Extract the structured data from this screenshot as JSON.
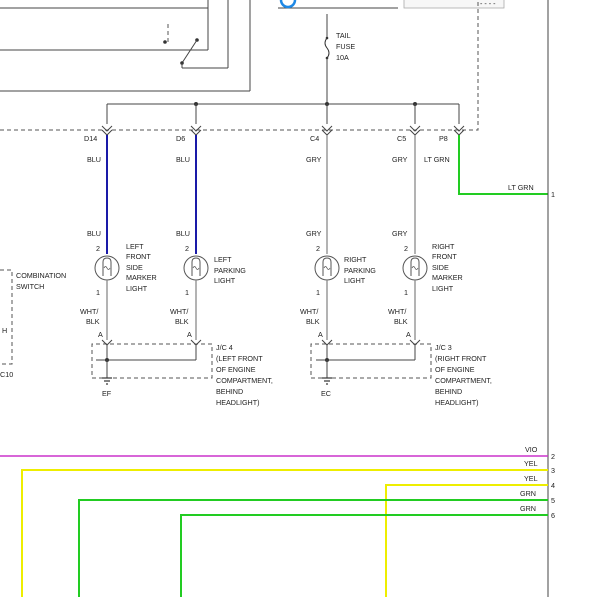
{
  "fuse": {
    "line1": "TAIL",
    "line2": "FUSE",
    "line3": "10A"
  },
  "connectors": {
    "d14": "D14",
    "d6": "D6",
    "c4": "C4",
    "c5": "C5",
    "p8": "P8",
    "a": "A",
    "pin1": "1",
    "pin2": "2"
  },
  "wires": {
    "blu": "BLU",
    "gry": "GRY",
    "lt_grn": "LT GRN",
    "wht_blk_1": "WHT/",
    "wht_blk_2": "BLK",
    "vio": "VIO",
    "yel": "YEL",
    "grn": "GRN"
  },
  "lights": {
    "left_front_side_marker": [
      "LEFT",
      "FRONT",
      "SIDE",
      "MARKER",
      "LIGHT"
    ],
    "left_parking": [
      "LEFT",
      "PARKING",
      "LIGHT"
    ],
    "right_parking": [
      "RIGHT",
      "PARKING",
      "LIGHT"
    ],
    "right_front_side_marker": [
      "RIGHT",
      "FRONT",
      "SIDE",
      "MARKER",
      "LIGHT"
    ]
  },
  "junctions": {
    "jc4": [
      "J/C 4",
      "(LEFT FRONT",
      "OF ENGINE",
      "COMPARTMENT,",
      "BEHIND",
      "HEADLIGHT)"
    ],
    "jc3": [
      "J/C 3",
      "(RIGHT FRONT",
      "OF ENGINE",
      "COMPARTMENT,",
      "BEHIND",
      "HEADLIGHT)"
    ]
  },
  "grounds": {
    "ef": "EF",
    "ec": "EC"
  },
  "combination_switch": {
    "line1": "COMBINATION",
    "line2": "SWITCH",
    "partial_h": "H",
    "partial_c10": "C10"
  },
  "right_pins": {
    "p1": "1",
    "p2": "2",
    "p3": "3",
    "p4": "4",
    "p5": "5",
    "p6": "6"
  },
  "colors": {
    "blu": "#1a1aa8",
    "gry": "#8a8a8a",
    "lt_grn": "#22cc22",
    "vio": "#cc33cc",
    "yel": "#eeee00",
    "grn": "#22cc22",
    "blue_icon": "#1e88e5"
  }
}
